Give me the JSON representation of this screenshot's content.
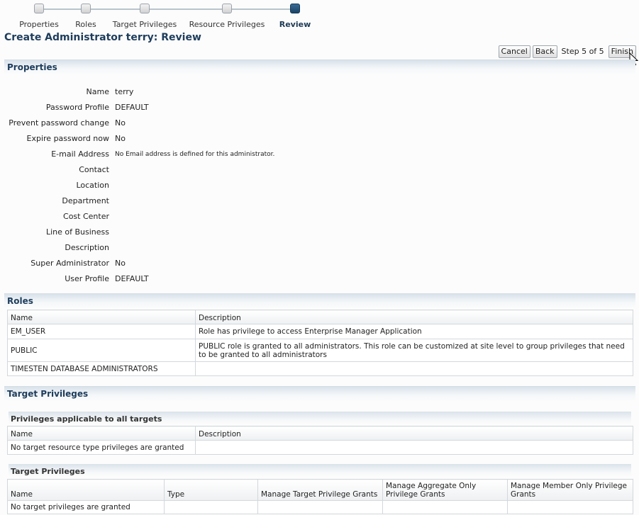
{
  "train": {
    "steps": [
      {
        "label": "Properties",
        "state": "visited"
      },
      {
        "label": "Roles",
        "state": "visited"
      },
      {
        "label": "Target Privileges",
        "state": "visited"
      },
      {
        "label": "Resource Privileges",
        "state": "visited"
      },
      {
        "label": "Review",
        "state": "current"
      }
    ]
  },
  "page_title": "Create Administrator terry: Review",
  "buttons": {
    "cancel": "Cancel",
    "back": "Back",
    "step": "Step 5 of 5",
    "finish": "Finish"
  },
  "properties": {
    "header": "Properties",
    "fields": [
      {
        "label": "Name",
        "value": "terry"
      },
      {
        "label": "Password Profile",
        "value": "DEFAULT"
      },
      {
        "label": "Prevent password change",
        "value": "No"
      },
      {
        "label": "Expire password now",
        "value": "No"
      },
      {
        "label": "E-mail Address",
        "value": "No Email address is defined for this administrator."
      },
      {
        "label": "Contact",
        "value": ""
      },
      {
        "label": "Location",
        "value": ""
      },
      {
        "label": "Department",
        "value": ""
      },
      {
        "label": "Cost Center",
        "value": ""
      },
      {
        "label": "Line of Business",
        "value": ""
      },
      {
        "label": "Description",
        "value": ""
      },
      {
        "label": "Super Administrator",
        "value": "No"
      },
      {
        "label": "User Profile",
        "value": "DEFAULT"
      }
    ]
  },
  "roles": {
    "header": "Roles",
    "columns": [
      "Name",
      "Description"
    ],
    "rows": [
      {
        "name": "EM_USER",
        "description": "Role has privilege to access Enterprise Manager Application"
      },
      {
        "name": "PUBLIC",
        "description": "PUBLIC role is granted to all administrators. This role can be customized at site level to group privileges that need to be granted to all administrators"
      },
      {
        "name": "TIMESTEN DATABASE ADMINISTRATORS",
        "description": ""
      }
    ]
  },
  "target_privileges": {
    "header": "Target Privileges",
    "all_targets": {
      "header": "Privileges applicable to all targets",
      "columns": [
        "Name",
        "Description"
      ],
      "empty_text": "No target resource type privileges are granted"
    },
    "targets": {
      "header": "Target Privileges",
      "columns": [
        "Name",
        "Type",
        "Manage Target Privilege Grants",
        "Manage Aggregate Only Privilege Grants",
        "Manage Member Only Privilege Grants"
      ],
      "empty_text": "No target privileges are granted"
    }
  }
}
